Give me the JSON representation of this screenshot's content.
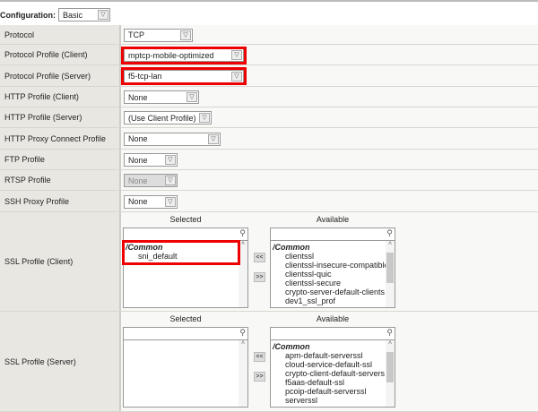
{
  "configuration": {
    "label": "Configuration:",
    "value": "Basic"
  },
  "rows": [
    {
      "label": "Protocol",
      "value": "TCP"
    },
    {
      "label": "Protocol Profile (Client)",
      "value": "mptcp-mobile-optimized"
    },
    {
      "label": "Protocol Profile (Server)",
      "value": "f5-tcp-lan"
    },
    {
      "label": "HTTP Profile (Client)",
      "value": "None"
    },
    {
      "label": "HTTP Profile (Server)",
      "value": "(Use Client Profile)"
    },
    {
      "label": "HTTP Proxy Connect Profile",
      "value": "None"
    },
    {
      "label": "FTP Profile",
      "value": "None"
    },
    {
      "label": "RTSP Profile",
      "value": "None"
    },
    {
      "label": "SSH Proxy Profile",
      "value": "None"
    }
  ],
  "ssl_client": {
    "label": "SSL Profile (Client)",
    "selected_header": "Selected",
    "available_header": "Available",
    "selected_group": "/Common",
    "selected": [
      "sni_default"
    ],
    "available_group": "/Common",
    "available": [
      "clientssl",
      "clientssl-insecure-compatible",
      "clientssl-quic",
      "clientssl-secure",
      "crypto-server-default-clients",
      "dev1_ssl_prof"
    ]
  },
  "ssl_server": {
    "label": "SSL Profile (Server)",
    "selected_header": "Selected",
    "available_header": "Available",
    "available_group": "/Common",
    "available": [
      "apm-default-serverssl",
      "cloud-service-default-ssl",
      "crypto-client-default-servers",
      "f5aas-default-ssl",
      "pcoip-default-serverssl",
      "serverssl"
    ]
  },
  "buttons": {
    "add": "<<",
    "remove": ">>"
  },
  "icons": {
    "search": "🔍",
    "chev": "⌄"
  }
}
